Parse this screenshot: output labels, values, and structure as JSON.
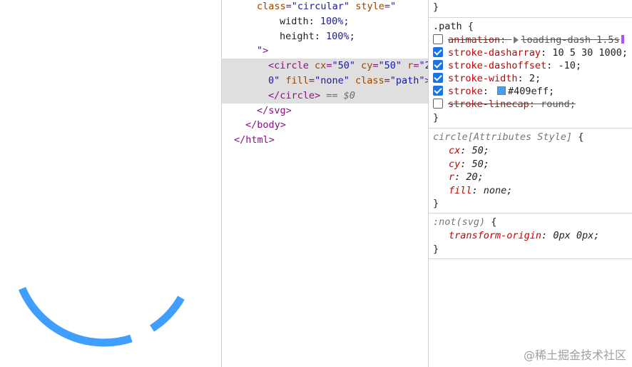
{
  "preview": {
    "arc_color": "#409eff"
  },
  "elements": {
    "lines": [
      {
        "indent": 3,
        "parts": [
          [
            "attr-name",
            "class"
          ],
          [
            "punct",
            "="
          ],
          [
            "attr-value",
            "\"circular\""
          ],
          [
            "plain",
            " "
          ],
          [
            "attr-name",
            "style"
          ],
          [
            "punct",
            "="
          ],
          [
            "attr-value",
            "\""
          ]
        ]
      },
      {
        "indent": 5,
        "parts": [
          [
            "css-name",
            "width"
          ],
          [
            "plain",
            ": "
          ],
          [
            "css-text",
            "100%"
          ],
          [
            "plain",
            ";"
          ]
        ]
      },
      {
        "indent": 5,
        "parts": [
          [
            "css-name",
            "height"
          ],
          [
            "plain",
            ": "
          ],
          [
            "css-text",
            "100%"
          ],
          [
            "plain",
            ";"
          ]
        ]
      },
      {
        "indent": 3,
        "parts": [
          [
            "attr-value",
            "\""
          ],
          [
            "tag",
            "&gt;"
          ]
        ]
      },
      {
        "indent": 4,
        "selected": true,
        "parts": [
          [
            "tag",
            "&lt;circle"
          ],
          [
            "plain",
            " "
          ],
          [
            "attr-name",
            "cx"
          ],
          [
            "punct",
            "="
          ],
          [
            "attr-value",
            "\"50\""
          ],
          [
            "plain",
            " "
          ],
          [
            "attr-name",
            "cy"
          ],
          [
            "punct",
            "="
          ],
          [
            "attr-value",
            "\"50\""
          ],
          [
            "plain",
            " "
          ],
          [
            "attr-name",
            "r"
          ],
          [
            "punct",
            "="
          ],
          [
            "attr-value",
            "\"2"
          ]
        ]
      },
      {
        "indent": 4,
        "selected": true,
        "parts": [
          [
            "attr-value",
            "0\""
          ],
          [
            "plain",
            " "
          ],
          [
            "attr-name",
            "fill"
          ],
          [
            "punct",
            "="
          ],
          [
            "attr-value",
            "\"none\""
          ],
          [
            "plain",
            " "
          ],
          [
            "attr-name",
            "class"
          ],
          [
            "punct",
            "="
          ],
          [
            "attr-value",
            "\"path\""
          ],
          [
            "tag",
            "&gt;"
          ]
        ]
      },
      {
        "indent": 4,
        "selected": true,
        "parts": [
          [
            "tag",
            "&lt;/circle&gt;"
          ],
          [
            "plain",
            " "
          ],
          [
            "ref",
            "== $0"
          ]
        ]
      },
      {
        "indent": 3,
        "parts": [
          [
            "tag",
            "&lt;/svg&gt;"
          ]
        ]
      },
      {
        "indent": 2,
        "parts": [
          [
            "tag",
            "&lt;/body&gt;"
          ]
        ]
      },
      {
        "indent": 1,
        "parts": [
          [
            "tag",
            "&lt;/html&gt;"
          ]
        ]
      }
    ],
    "ellipsis": "•••"
  },
  "styles": {
    "top_brace": "}",
    "path_rule": {
      "selector": ".path {",
      "props": [
        {
          "checked": false,
          "name": "animation",
          "value": "loading-dash 1.5s",
          "disabled": true,
          "has_tri": true,
          "has_mark": true
        },
        {
          "checked": true,
          "name": "stroke-dasharray",
          "value": "10 5 30 1000;"
        },
        {
          "checked": true,
          "name": "stroke-dashoffset",
          "value": "-10;"
        },
        {
          "checked": true,
          "name": "stroke-width",
          "value": "2;"
        },
        {
          "checked": true,
          "name": "stroke",
          "value": "#409eff;",
          "swatch": "#409eff"
        },
        {
          "checked": false,
          "name": "stroke-linecap",
          "value": "round;",
          "disabled": true
        }
      ],
      "close": "}"
    },
    "attr_rule": {
      "selector": "circle[Attributes Style]",
      "brace": " {",
      "props": [
        {
          "name": "cx",
          "value": "50;"
        },
        {
          "name": "cy",
          "value": "50;"
        },
        {
          "name": "r",
          "value": "20;"
        },
        {
          "name": "fill",
          "value": "none;"
        }
      ],
      "close": "}"
    },
    "not_rule": {
      "selector": ":not(svg)",
      "brace": " {",
      "props": [
        {
          "name": "transform-origin",
          "value": "0px 0px;"
        }
      ],
      "close": "}"
    }
  },
  "watermark": "@稀土掘金技术社区"
}
